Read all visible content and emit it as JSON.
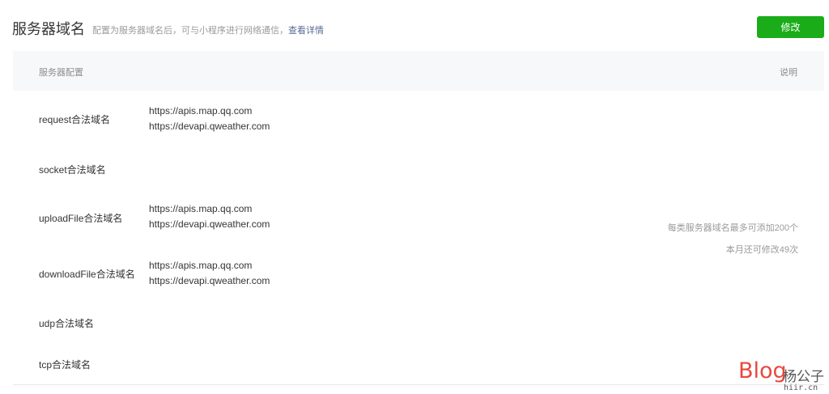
{
  "header": {
    "title": "服务器域名",
    "description": "配置为服务器域名后，可与小程序进行网络通信，",
    "details_link": "查看详情",
    "modify_button": "修改"
  },
  "table": {
    "col_config": "服务器配置",
    "col_note": "说明"
  },
  "rows": [
    {
      "label": "request合法域名",
      "values": [
        "https://apis.map.qq.com",
        "https://devapi.qweather.com"
      ]
    },
    {
      "label": "socket合法域名",
      "values": []
    },
    {
      "label": "uploadFile合法域名",
      "values": [
        "https://apis.map.qq.com",
        "https://devapi.qweather.com"
      ]
    },
    {
      "label": "downloadFile合法域名",
      "values": [
        "https://apis.map.qq.com",
        "https://devapi.qweather.com"
      ]
    },
    {
      "label": "udp合法域名",
      "values": []
    },
    {
      "label": "tcp合法域名",
      "values": []
    }
  ],
  "notes": {
    "limit": "每类服务器域名最多可添加200个",
    "remaining": "本月还可修改49次"
  },
  "watermark": {
    "blog": "Blog",
    "name": "杨公子",
    "url": "hiir.cn",
    "color": "#e9483f"
  }
}
